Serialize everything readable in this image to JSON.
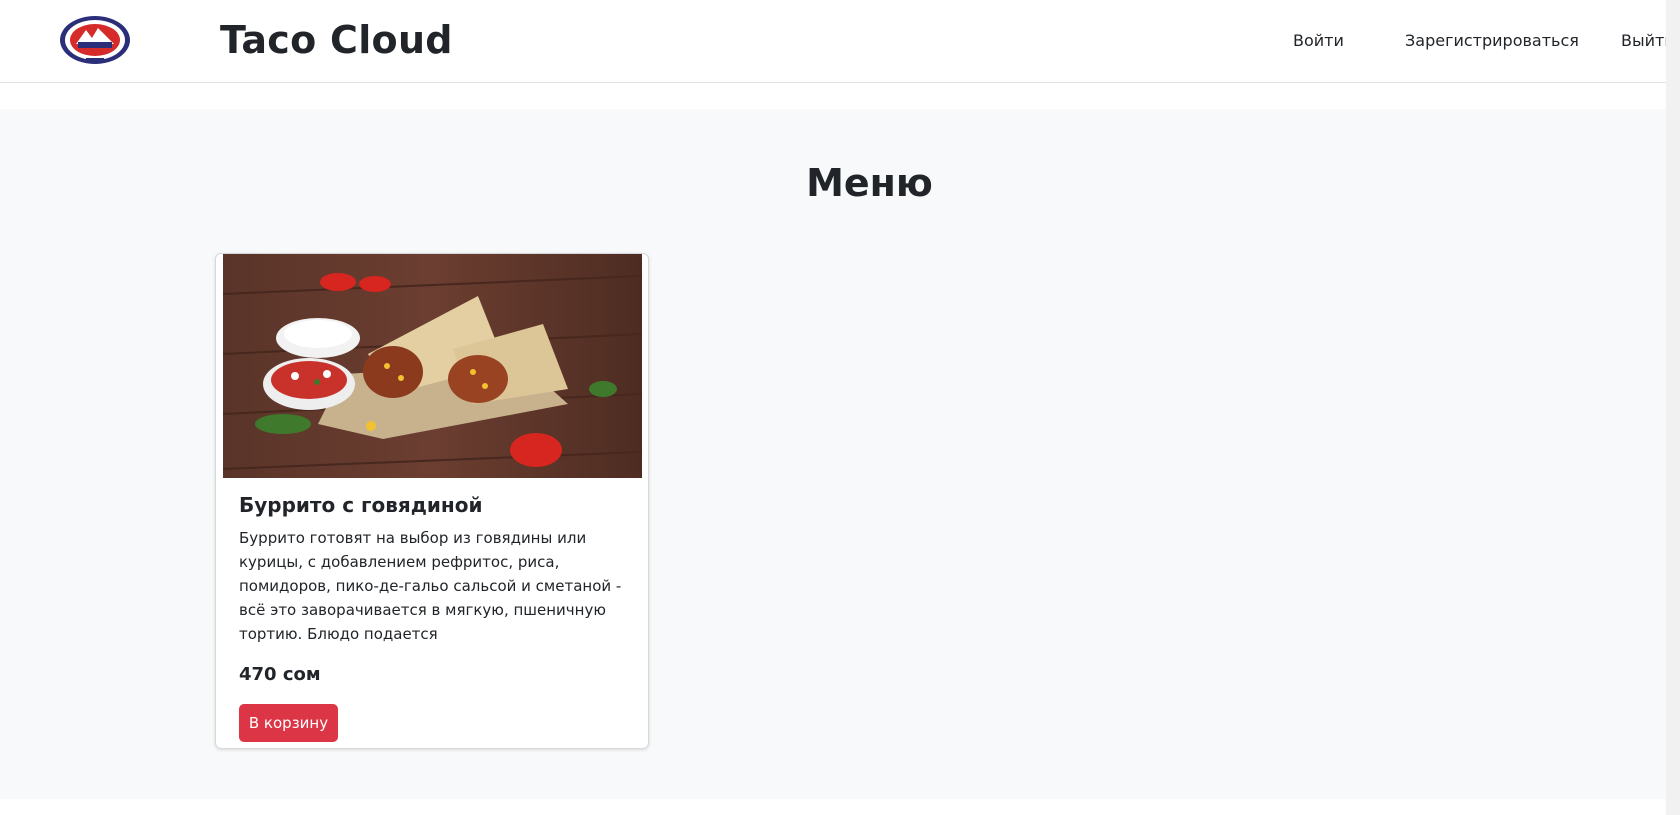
{
  "header": {
    "logo_icon": "ala-too-university-emblem-icon",
    "brand": "Taco Cloud",
    "nav": [
      {
        "label": "Войти"
      },
      {
        "label": "Зарегистрироваться"
      },
      {
        "label": "Выйти"
      }
    ]
  },
  "menu": {
    "title": "Меню",
    "items": [
      {
        "image_icon": "burrito-photo",
        "name": "Буррито с говядиной",
        "description": "Буррито готовят на выбор из говядины или курицы, с добавлением рефритос, риса, помидоров, пико-де-гальо сальсой и сметаной - всё это заворачивается в мягкую, пшеничную тортию. Блюдо подается",
        "price": "470 сом",
        "button_label": "В корзину"
      }
    ]
  },
  "colors": {
    "accent": "#dc3545",
    "section_bg": "#f8f9fa",
    "text": "#212529"
  }
}
